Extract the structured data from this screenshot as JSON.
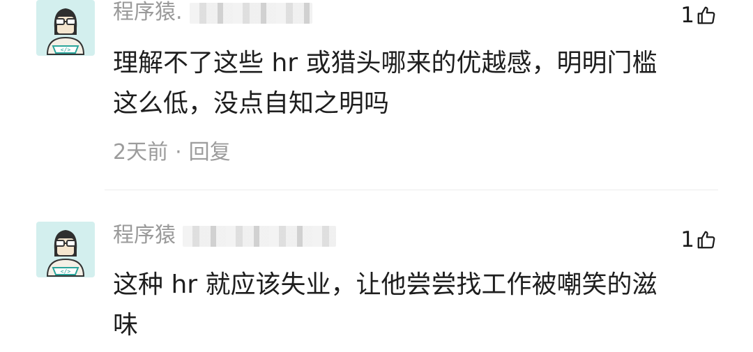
{
  "comments": [
    {
      "username": "程序猿.",
      "likes": "1",
      "lines": [
        "理解不了这些 hr 或猎头哪来的优越感，明明门槛",
        "这么低，没点自知之明吗"
      ],
      "time": "2天前",
      "separator": "·",
      "reply_label": "回复"
    },
    {
      "username": "程序猿",
      "likes": "1",
      "lines": [
        "这种 hr 就应该失业，让他尝尝找工作被嘲笑的滋",
        "味"
      ]
    }
  ],
  "icons": {
    "avatar": "programmer-avatar-icon",
    "like": "thumbs-up-icon"
  },
  "colors": {
    "avatar_bg": "#d3efee",
    "username": "#9a9a9a",
    "content": "#1e1e1e",
    "meta": "#9c9c9c"
  }
}
